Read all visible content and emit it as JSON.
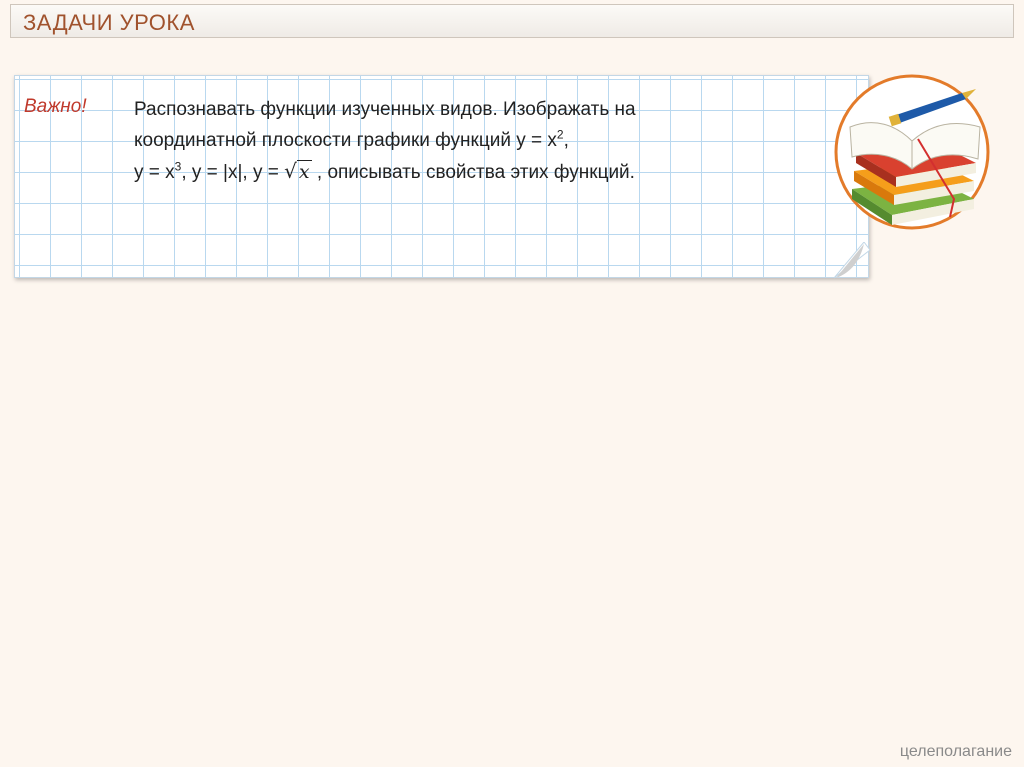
{
  "header": {
    "title": "ЗАДАЧИ УРОКА"
  },
  "note": {
    "label": "Важно!",
    "line1": "Распознавать функции изученных видов. Изображать на",
    "line2_prefix": "координатной плоскости графики функций ",
    "line2_formula": "y = x",
    "line2_exp": "2",
    "line2_suffix": ",",
    "line3_a": "y = x",
    "line3_exp": "3",
    "line3_b": ", y = |x|, y = ",
    "sqrt_symbol": "√",
    "sqrt_arg": "x",
    "line3_c": " , описывать свойства этих функций."
  },
  "illustration": {
    "icon": "books-with-pen-icon"
  },
  "footer": {
    "text": "целеполагание"
  }
}
